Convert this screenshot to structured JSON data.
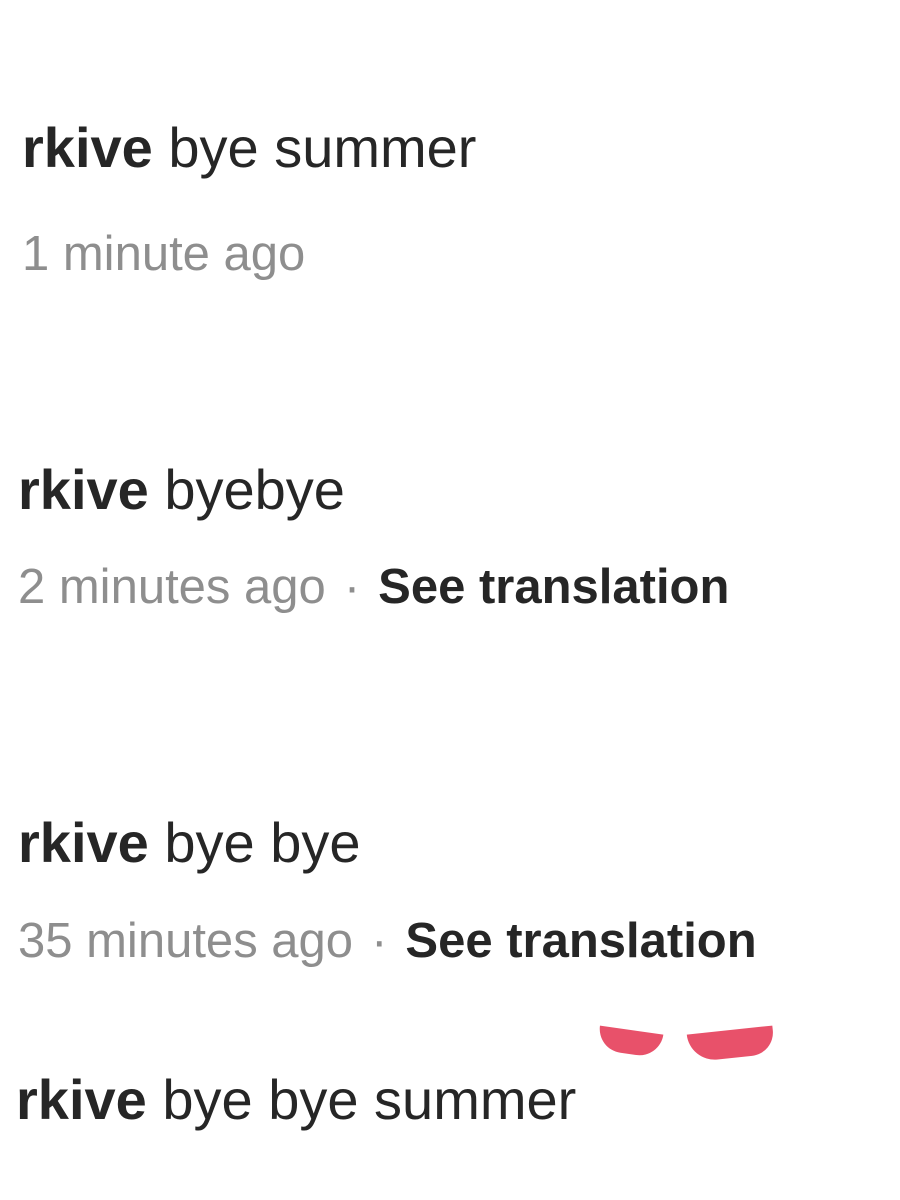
{
  "comments": [
    {
      "username": "rkive",
      "text": "bye summer",
      "timestamp": "1 minute ago",
      "translation_label": ""
    },
    {
      "username": "rkive",
      "text": "byebye",
      "timestamp": "2 minutes ago",
      "separator": "·",
      "translation_label": "See translation"
    },
    {
      "username": "rkive",
      "text": "bye bye",
      "timestamp": "35 minutes ago",
      "separator": "·",
      "translation_label": "See translation"
    },
    {
      "username": "rkive",
      "text": "bye bye summer"
    }
  ],
  "colors": {
    "text": "#262626",
    "meta": "#8e8e8e",
    "accent": "#e8516a"
  }
}
